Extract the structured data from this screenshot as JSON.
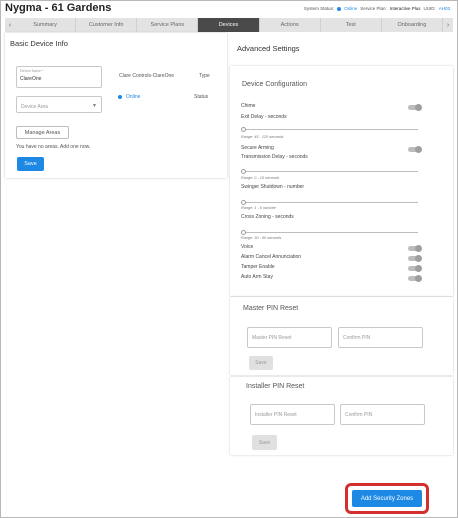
{
  "header": {
    "title": "Nygma - 61 Gardens",
    "system_status_label": "System Status:",
    "system_status_value": "Online",
    "service_plan_label": "Service Plan:",
    "service_plan_value": "Interactive Plus",
    "uuid_label": "UUID:",
    "uuid_value": "AH03"
  },
  "tabs": {
    "prev_icon": "‹",
    "next_icon": "›",
    "items": [
      "Summary",
      "Customer Info",
      "Service Plans",
      "Devices",
      "Actions",
      "Test",
      "Onboarding"
    ],
    "active": "Devices"
  },
  "basic": {
    "title": "Basic Device Info",
    "device_name_label": "Device Name *",
    "device_name_value": "ClareOne",
    "device_area_placeholder": "Device Area",
    "type_value": "Clare Controls-ClareOne",
    "type_label": "Type",
    "status_value": "Online",
    "status_label": "Status",
    "manage_areas": "Manage Areas",
    "no_areas_text": "You have no areas. Add one now.",
    "save": "Save"
  },
  "advanced": {
    "title": "Advanced Settings",
    "device_config_title": "Device Configuration",
    "chime": "Chime",
    "exit_delay": "Exit Delay - seconds",
    "exit_delay_range": "Range: 45 - 120 seconds",
    "secure_arming": "Secure Arming",
    "transmission_delay": "Transmission Delay - seconds",
    "transmission_delay_range": "Range: 0 - 15 seconds",
    "swinger_shutdown": "Swinger Shutdown - number",
    "swinger_shutdown_range": "Range: 1 - 6 number",
    "cross_zoning": "Cross Zoning - seconds",
    "cross_zoning_range": "Range: 30 - 60 seconds",
    "voice": "Voice",
    "alarm_cancel": "Alarm Cancel Annunciation",
    "tamper_enable": "Tamper Enable",
    "auto_arm_stay": "Auto Arm Stay",
    "master_pin_title": "Master PIN Reset",
    "master_pin_placeholder": "Master PIN Reset",
    "master_confirm_placeholder": "Confirm PIN",
    "master_save": "Save",
    "installer_pin_title": "Installer PIN Reset",
    "installer_pin_placeholder": "Installer PIN Reset",
    "installer_confirm_placeholder": "Confirm PIN",
    "installer_save": "Save",
    "add_security_zones": "Add Security Zones"
  },
  "colors": {
    "accent": "#1e88e5",
    "active_tab": "#4a4a4a",
    "highlight": "#d32f2f"
  }
}
